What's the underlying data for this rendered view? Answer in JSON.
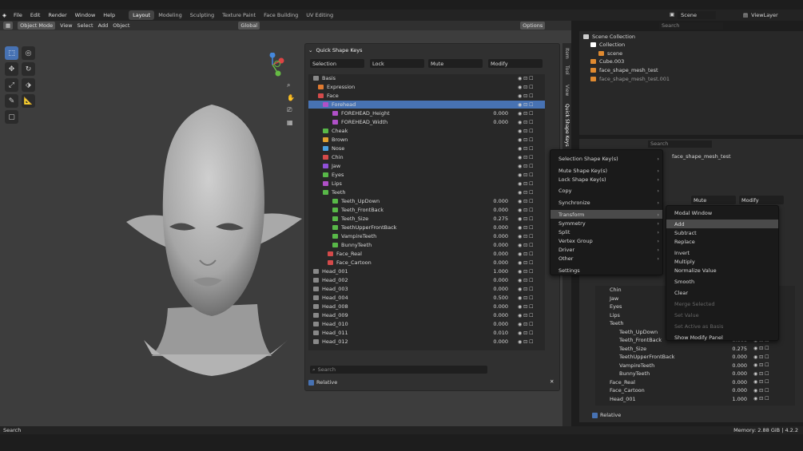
{
  "menubar": {
    "items": [
      "File",
      "Edit",
      "Render",
      "Window",
      "Help"
    ],
    "workspaces": [
      "Layout",
      "Modeling",
      "Sculpting",
      "Texture Paint",
      "Face Building",
      "UV Editing"
    ],
    "scene": "Scene",
    "view_layer": "ViewLayer"
  },
  "viewport": {
    "mode": "Object Mode",
    "menus": [
      "View",
      "Select",
      "Add",
      "Object"
    ],
    "orientation": "Global",
    "options": "Options"
  },
  "panel": {
    "title": "Quick Shape Keys",
    "filters": [
      "Selection",
      "Lock",
      "Mute",
      "Modify"
    ],
    "search_placeholder": "Search",
    "relative": "Relative",
    "rows": [
      {
        "name": "Basis",
        "value": "",
        "color": "#888"
      },
      {
        "name": "Expression",
        "value": "",
        "color": "#e07a30"
      },
      {
        "name": "Face",
        "value": "",
        "color": "#d44a4a"
      },
      {
        "name": "Forehead",
        "value": "",
        "color": "#b050c8"
      },
      {
        "name": "FOREHEAD_Height",
        "value": "0.000",
        "color": "#b050c8"
      },
      {
        "name": "FOREHEAD_Width",
        "value": "0.000",
        "color": "#b050c8"
      },
      {
        "name": "Cheak",
        "value": "",
        "color": "#58b848"
      },
      {
        "name": "Brown",
        "value": "",
        "color": "#e0a030"
      },
      {
        "name": "Nose",
        "value": "",
        "color": "#4aa0e0"
      },
      {
        "name": "Chin",
        "value": "",
        "color": "#d44a4a"
      },
      {
        "name": "Jaw",
        "value": "",
        "color": "#9050d8"
      },
      {
        "name": "Eyes",
        "value": "",
        "color": "#58b848"
      },
      {
        "name": "Lips",
        "value": "",
        "color": "#b050c8"
      },
      {
        "name": "Teeth",
        "value": "",
        "color": "#58b848"
      },
      {
        "name": "Teeth_UpDown",
        "value": "0.000",
        "color": "#58b848"
      },
      {
        "name": "Teeth_FrontBack",
        "value": "0.000",
        "color": "#58b848"
      },
      {
        "name": "Teeth_Size",
        "value": "0.275",
        "color": "#58b848"
      },
      {
        "name": "TeethUpperFrontBack",
        "value": "0.000",
        "color": "#58b848"
      },
      {
        "name": "VampireTeeth",
        "value": "0.000",
        "color": "#58b848"
      },
      {
        "name": "BunnyTeeth",
        "value": "0.000",
        "color": "#58b848"
      },
      {
        "name": "Face_Real",
        "value": "0.000",
        "color": "#d44a4a"
      },
      {
        "name": "Face_Cartoon",
        "value": "0.000",
        "color": "#d44a4a"
      },
      {
        "name": "Head_001",
        "value": "1.000",
        "color": "#888"
      },
      {
        "name": "Head_002",
        "value": "0.000",
        "color": "#888"
      },
      {
        "name": "Head_003",
        "value": "0.000",
        "color": "#888"
      },
      {
        "name": "Head_004",
        "value": "0.500",
        "color": "#888"
      },
      {
        "name": "Head_008",
        "value": "0.000",
        "color": "#888"
      },
      {
        "name": "Head_009",
        "value": "0.000",
        "color": "#888"
      },
      {
        "name": "Head_010",
        "value": "0.000",
        "color": "#888"
      },
      {
        "name": "Head_011",
        "value": "0.010",
        "color": "#888"
      },
      {
        "name": "Head_012",
        "value": "0.000",
        "color": "#888"
      }
    ]
  },
  "side_tabs": [
    "Item",
    "Tool",
    "View",
    "Quick Shape Keys"
  ],
  "outliner": {
    "search_placeholder": "Search",
    "items": [
      "Scene Collection",
      "Collection",
      "scene",
      "Cube.003",
      "face_shape_mesh_test",
      "face_shape_mesh_test.001"
    ]
  },
  "properties": {
    "search_placeholder": "Search",
    "object": "face_shape_mesh_test",
    "filters": [
      "Mute",
      "Modify"
    ],
    "relative": "Relative",
    "rows": [
      {
        "name": "Chin",
        "value": ""
      },
      {
        "name": "Jaw",
        "value": ""
      },
      {
        "name": "Eyes",
        "value": ""
      },
      {
        "name": "Lips",
        "value": ""
      },
      {
        "name": "Teeth",
        "value": ""
      },
      {
        "name": "Teeth_UpDown",
        "value": "0.000"
      },
      {
        "name": "Teeth_FrontBack",
        "value": "0.000"
      },
      {
        "name": "Teeth_Size",
        "value": "0.275"
      },
      {
        "name": "TeethUpperFrontBack",
        "value": "0.000"
      },
      {
        "name": "VampireTeeth",
        "value": "0.000"
      },
      {
        "name": "BunnyTeeth",
        "value": "0.000"
      },
      {
        "name": "Face_Real",
        "value": "0.000"
      },
      {
        "name": "Face_Cartoon",
        "value": "0.000"
      },
      {
        "name": "Head_001",
        "value": "1.000"
      }
    ]
  },
  "context_menu": {
    "items": [
      "Selection Shape Key(s)",
      "Mute Shape Key(s)",
      "Lock Shape Key(s)",
      "Copy",
      "Synchronize",
      "Transform",
      "Symmetry",
      "Split",
      "Vertex Group",
      "Driver",
      "Other",
      "Settings"
    ]
  },
  "transform_menu": {
    "items": [
      "Modal Window",
      "Add",
      "Subtract",
      "Replace",
      "Invert",
      "Multiply",
      "Normalize Value",
      "Smooth",
      "Clear",
      "Merge Selected",
      "Set Value",
      "Set Active as Basis",
      "Show Modify Panel"
    ]
  },
  "status": {
    "left": "Search",
    "memory": "Memory: 2.88 GiB",
    "version": "4.2.2"
  }
}
